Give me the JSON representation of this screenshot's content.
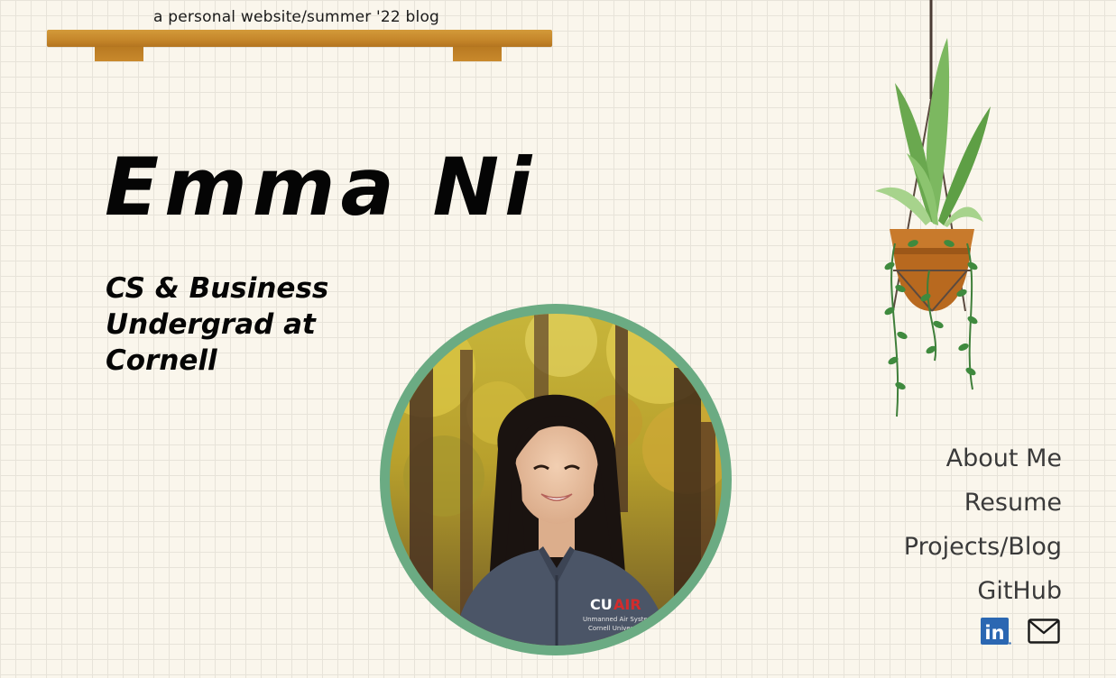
{
  "header": {
    "tagline": "a personal website/summer '22 blog"
  },
  "hero": {
    "name": "Emma Ni",
    "subtitle": "CS & Business Undergrad at Cornell"
  },
  "nav": {
    "items": [
      {
        "label": "About Me"
      },
      {
        "label": "Resume"
      },
      {
        "label": "Projects/Blog"
      },
      {
        "label": "GitHub"
      }
    ]
  },
  "social": {
    "icons": [
      "linkedin-icon",
      "mail-icon"
    ],
    "linkedin_text": "in"
  },
  "photo": {
    "jacket_logo": "CU AIR",
    "jacket_text": [
      "Unmanned Air Systems",
      "Cornell University"
    ]
  },
  "colors": {
    "background": "#faf6ec",
    "shelf": "#c5862a",
    "photo_ring": "#6bab83",
    "nav_text": "#3a3a3a",
    "linkedin_blue": "#2b67b2"
  }
}
